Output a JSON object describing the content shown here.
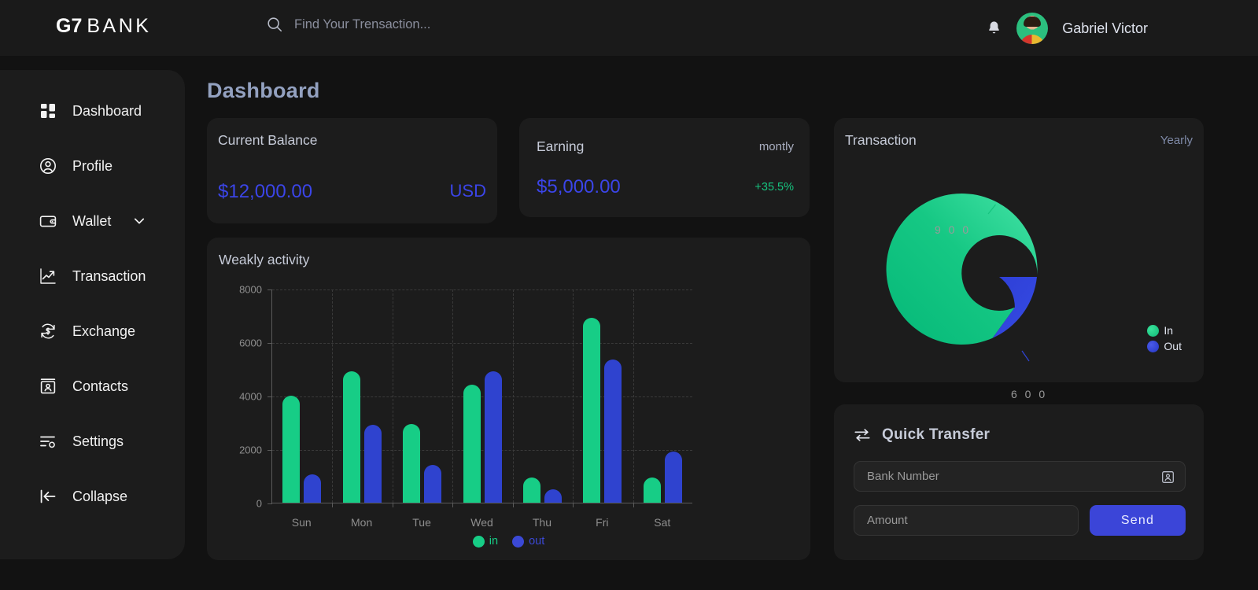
{
  "brand": {
    "mark": "G7",
    "word": "BANK"
  },
  "search": {
    "placeholder": "Find Your Trensaction...",
    "value": "",
    "icon": "search-icon"
  },
  "user": {
    "name": "Gabriel Victor",
    "bell_icon": "bell-icon",
    "avatar_icon": "avatar"
  },
  "sidebar": {
    "items": [
      {
        "label": "Dashboard",
        "icon": "grid-icon"
      },
      {
        "label": "Profile",
        "icon": "user-circle-icon"
      },
      {
        "label": "Wallet",
        "icon": "wallet-icon",
        "chevron": "chevron-down-icon"
      },
      {
        "label": "Transaction",
        "icon": "trending-up-icon"
      },
      {
        "label": "Exchange",
        "icon": "currency-exchange-icon"
      },
      {
        "label": "Contacts",
        "icon": "contact-card-icon"
      },
      {
        "label": "Settings",
        "icon": "settings-sliders-icon"
      },
      {
        "label": "Collapse",
        "icon": "arrow-left-bar-icon"
      }
    ]
  },
  "page": {
    "title": "Dashboard"
  },
  "balance_card": {
    "title": "Current Balance",
    "amount": "$12,000.00",
    "currency": "USD"
  },
  "earning_card": {
    "title": "Earning",
    "period": "montly",
    "amount": "$5,000.00",
    "change": "+35.5%"
  },
  "weekly_card": {
    "title": "Weakly activity"
  },
  "transaction_card": {
    "title": "Transaction",
    "period": "Yearly"
  },
  "quick_transfer": {
    "title": "Quick Transfer",
    "icon": "transfer-arrows-icon",
    "bank_placeholder": "Bank Number",
    "bank_value": "",
    "bank_field_icon": "contact-card-icon",
    "amount_placeholder": "Amount",
    "amount_value": "",
    "send_label": "Send"
  },
  "colors": {
    "background": "#121212",
    "panel": "#1c1c1c",
    "accent_blue": "#3b45e8",
    "accent_green": "#17cd86",
    "bar_out": "#2f43cf",
    "text": "#dfe3ee",
    "muted": "#8e8e8e"
  },
  "chart_data": [
    {
      "type": "bar",
      "title": "Weakly activity",
      "categories": [
        "Sun",
        "Mon",
        "Tue",
        "Wed",
        "Thu",
        "Fri",
        "Sat"
      ],
      "series": [
        {
          "name": "in",
          "color": "#17cd86",
          "values": [
            4000,
            4900,
            2950,
            4400,
            950,
            6900,
            950
          ]
        },
        {
          "name": "out",
          "color": "#2f43cf",
          "values": [
            1050,
            2900,
            1400,
            4900,
            500,
            5350,
            1900
          ]
        }
      ],
      "xlabel": "",
      "ylabel": "",
      "ylim": [
        0,
        8000
      ],
      "yticks": [
        0,
        2000,
        4000,
        6000,
        8000
      ],
      "grid": true,
      "legend": "bottom-center"
    },
    {
      "type": "pie",
      "title": "Transaction",
      "subtitle": "Yearly",
      "donut": true,
      "labels": [
        "In",
        "Out"
      ],
      "values": [
        900,
        600
      ],
      "value_labels": [
        "9 0 0",
        "6 0 0"
      ],
      "colors": [
        "#16c47f",
        "#2f43cf"
      ],
      "legend": "bottom-right"
    }
  ]
}
